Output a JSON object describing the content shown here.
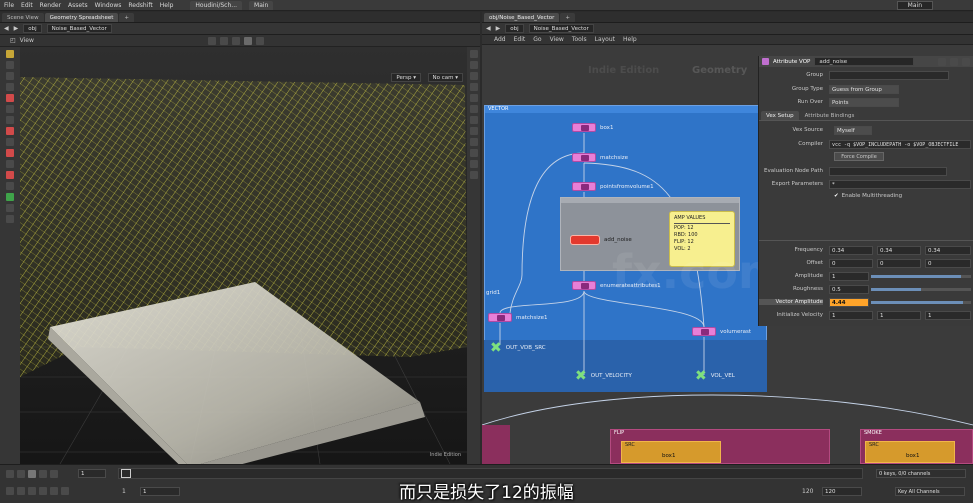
{
  "menubar": {
    "items": [
      "File",
      "Edit",
      "Render",
      "Assets",
      "Windows",
      "Redshift",
      "Help"
    ],
    "shelf_a": "Houdini/Sch...",
    "shelf_b": "Main",
    "right_label": "Main"
  },
  "left": {
    "tabs": [
      "Scene View",
      "Geometry Spreadsheet"
    ],
    "path_root": "obj",
    "path_node": "Noise_Based_Vector",
    "view_title": "View",
    "persp": "Persp ▾",
    "nocam": "No cam ▾",
    "corner": "Indie Edition"
  },
  "right": {
    "tab": "obj/Noise_Based_Vector",
    "path_root": "obj",
    "path_node": "Noise_Based_Vector",
    "menu": [
      "Add",
      "Edit",
      "Go",
      "View",
      "Tools",
      "Layout",
      "Help"
    ],
    "watermark_a": "Indie Edition",
    "watermark_b": "Geometry",
    "network_box": "VECTOR",
    "nodes": {
      "box": "box1",
      "match1": "matchsize",
      "points": "pointsfromvolume1",
      "noise": "add_noise",
      "enum": "enumerateattributes1",
      "match2": "matchsize1",
      "volrast": "volumerast",
      "out_vel": "OUT_VELOCITY",
      "out_sdf": "OUT_VDB_SRC",
      "vol_vel": "VOL_VEL",
      "grid": "grid1"
    },
    "sticky": [
      "AMP VALUES",
      "POP: 12",
      "RBD: 100",
      "FLIP: 12",
      "VOL: 2"
    ],
    "flip_box": "FLIP",
    "smoke_box": "SMOKE",
    "src_a": "SRC",
    "src_b": "SRC",
    "box1_a": "box1",
    "box1_b": "box1"
  },
  "params": {
    "header_type": "Attribute VOP",
    "header_name": "add_noise",
    "group_label": "Group",
    "group_type_label": "Group Type",
    "group_type_value": "Guess from Group",
    "run_over_label": "Run Over",
    "run_over_value": "Points",
    "tabs": [
      "Vex Setup",
      "Attribute Bindings"
    ],
    "vex_source_label": "Vex Source",
    "vex_source_value": "Myself",
    "compiler_label": "Compiler",
    "compiler_value": "vcc -q $VOP_INCLUDEPATH -o $VOP_OBJECTFILE",
    "force_compile": "Force Compile",
    "eval_label": "Evaluation Node Path",
    "export_label": "Export Parameters",
    "export_value": "*",
    "multithread": "Enable Multithreading",
    "rows": [
      {
        "label": "Frequency",
        "v": [
          "0.34",
          "0.34",
          "0.34"
        ]
      },
      {
        "label": "Offset",
        "v": [
          "0",
          "0",
          "0"
        ]
      },
      {
        "label": "Amplitude",
        "v": [
          "1"
        ]
      },
      {
        "label": "Roughness",
        "v": [
          "0.5"
        ]
      },
      {
        "label": "Vector Amplitude",
        "v": [
          "4.44"
        ]
      },
      {
        "label": "Initialize Velocity",
        "v": [
          "1",
          "1",
          "1"
        ]
      }
    ]
  },
  "timeline": {
    "frame": "1",
    "start": "1",
    "start2": "1",
    "end": "120",
    "end2": "120",
    "keys": "0 keys, 0/0 channels",
    "keyall": "Key All Channels"
  },
  "subtitle": "而只是损失了12的振幅",
  "watermark": "fx.com",
  "colors": {
    "accent": "#ffa42a",
    "curve": "#e8e44a",
    "network_box": "#2f74c8",
    "node": "#e77fd7",
    "out": "#7ee07e"
  }
}
